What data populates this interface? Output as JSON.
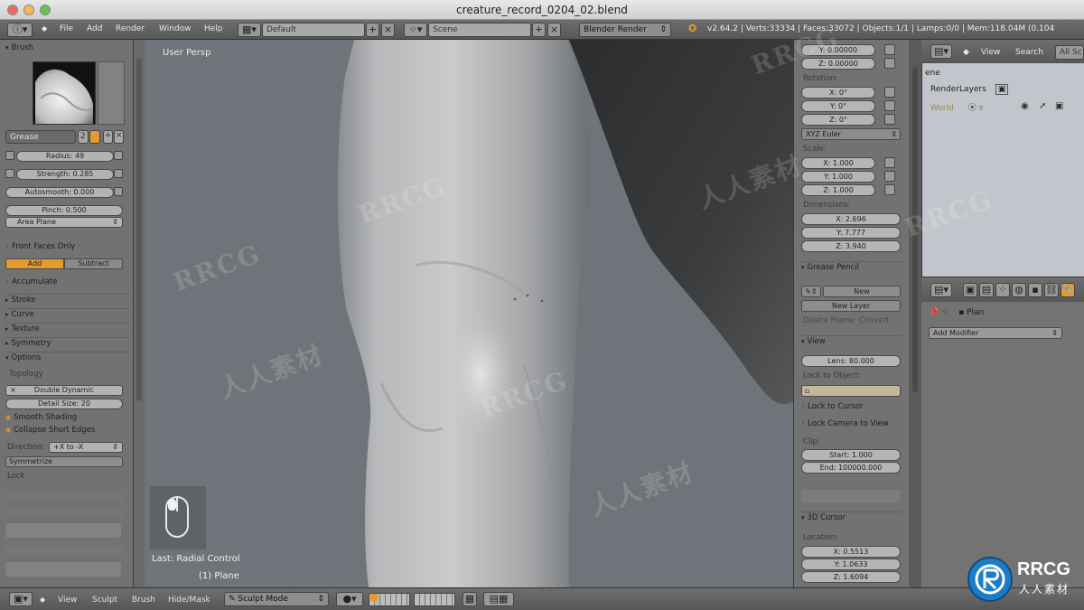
{
  "window": {
    "title": "creature_record_0204_02.blend"
  },
  "topbar": {
    "menus": [
      "File",
      "Add",
      "Render",
      "Window",
      "Help"
    ],
    "layout": "Default",
    "scene": "Scene",
    "engine": "Blender Render",
    "stats": "v2.64.2 | Verts:33334 | Faces:33072 | Objects:1/1 | Lamps:0/0 | Mem:118.04M (0.104"
  },
  "tool_shelf": {
    "header": "Brush",
    "brush_name": "Grease",
    "users": "2",
    "radius": "Radius: 49",
    "strength": "Strength: 0.285",
    "autosmooth": "Autosmooth: 0.000",
    "pinch": "Pinch: 0.500",
    "plane": "Area Plane",
    "front_faces": "Front Faces Only",
    "add": "Add",
    "subtract": "Subtract",
    "accumulate": "Accumulate",
    "stroke": "Stroke",
    "curve": "Curve",
    "texture": "Texture",
    "symmetry": "Symmetry",
    "options": "Options",
    "topology": "Topology",
    "double_dynamic": "Double Dynamic",
    "detail_size": "Detail Size: 20",
    "smooth_shading": "Smooth Shading",
    "collapse_short": "Collapse Short Edges",
    "direction_label": "Direction:",
    "direction_value": "+X to -X",
    "symmetrize": "Symmetrize",
    "lock": "Lock"
  },
  "viewport": {
    "label": "User Persp",
    "last_op": "Last: Radial Control",
    "object": "(1) Plane"
  },
  "properties": {
    "loc_y": "Y: 0.00000",
    "loc_z": "Z: 0.00000",
    "rotation": "Rotation:",
    "rot_x": "X: 0°",
    "rot_y": "Y: 0°",
    "rot_z": "Z: 0°",
    "rot_mode": "XYZ Euler",
    "scale": "Scale:",
    "scale_x": "X: 1.000",
    "scale_y": "Y: 1.000",
    "scale_z": "Z: 1.000",
    "dimensions": "Dimensions:",
    "dim_x": "X: 2.696",
    "dim_y": "Y: 7.777",
    "dim_z": "Z: 3.940",
    "grease_pencil": "Grease Pencil",
    "new": "New",
    "new_layer": "New Layer",
    "delete_frame": "Delete Frame",
    "convert": "Convert",
    "view": "View",
    "lens": "Lens: 80.000",
    "lock_to_object": "Lock to Object:",
    "lock_to_cursor": "Lock to Cursor",
    "lock_camera": "Lock Camera to View",
    "clip": "Clip:",
    "clip_start": "Start: 1.000",
    "clip_end": "End: 100000.000",
    "cursor_3d": "3D Cursor",
    "location": "Location:",
    "cur_x": "X: 0.5513",
    "cur_y": "Y: 1.0633",
    "cur_z": "Z: 1.6094"
  },
  "outliner": {
    "view": "View",
    "search": "Search",
    "all_scenes": "All Sc",
    "scene_label": "ene",
    "render_layers": "RenderLayers",
    "world": "World"
  },
  "props_editor": {
    "object": "Plan",
    "add_modifier": "Add Modifier"
  },
  "bottombar": {
    "menus": [
      "View",
      "Sculpt",
      "Brush",
      "Hide/Mask"
    ],
    "mode": "Sculpt Mode"
  },
  "watermark": {
    "text_a": "RRCG",
    "text_b": "人人素材",
    "logo_a": "RRCG",
    "logo_b": "人人素材"
  },
  "colors": {
    "active": "#e39b2f",
    "bg": "#727272",
    "viewport": "#6e7479"
  }
}
